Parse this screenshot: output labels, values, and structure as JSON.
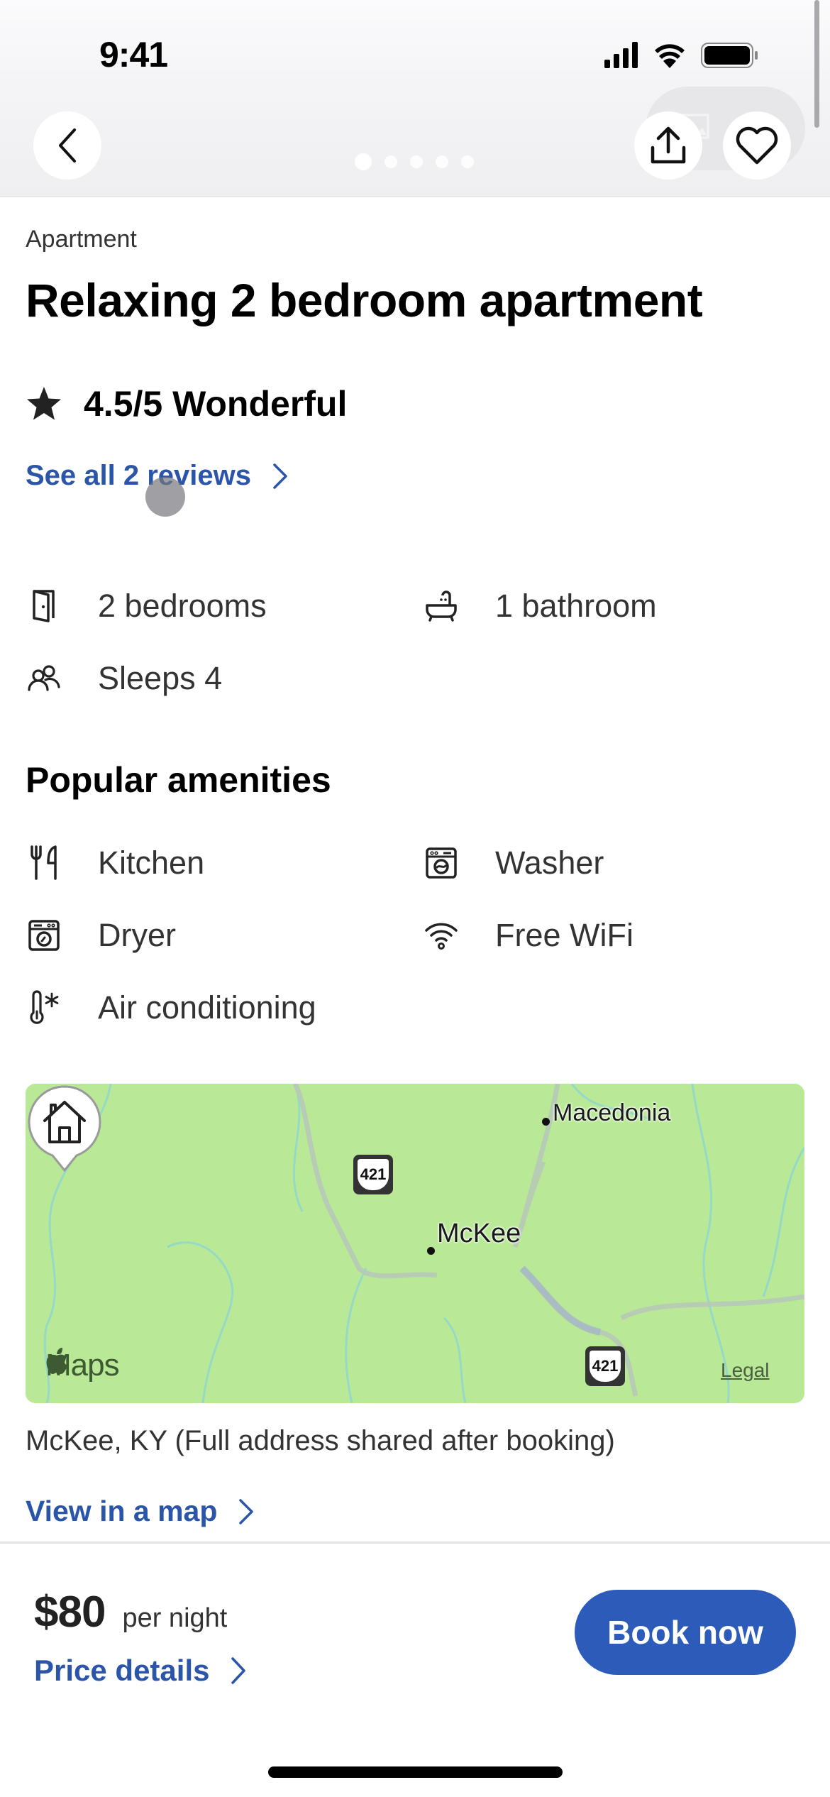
{
  "status_bar": {
    "time": "9:41",
    "icons": [
      "signal-icon",
      "wifi-icon",
      "battery-icon"
    ]
  },
  "header": {
    "back_icon": "chevron-left-icon",
    "share_icon": "share-icon",
    "favorite_icon": "heart-outline-icon",
    "gallery_dots": {
      "count": 5,
      "active_index": 0
    }
  },
  "listing": {
    "type": "Apartment",
    "title": "Relaxing 2 bedroom apartment",
    "rating": {
      "icon": "star-icon",
      "text": "4.5/5 Wonderful"
    },
    "reviews_link": "See all 2 reviews"
  },
  "facts": [
    {
      "icon": "door-icon",
      "label": "2 bedrooms"
    },
    {
      "icon": "bathtub-icon",
      "label": "1 bathroom"
    },
    {
      "icon": "people-icon",
      "label": "Sleeps 4"
    }
  ],
  "amenities": {
    "title": "Popular amenities",
    "items": [
      {
        "icon": "utensils-icon",
        "label": "Kitchen"
      },
      {
        "icon": "washer-icon",
        "label": "Washer"
      },
      {
        "icon": "dryer-icon",
        "label": "Dryer"
      },
      {
        "icon": "wifi-icon",
        "label": "Free WiFi"
      },
      {
        "icon": "thermometer-snowflake-icon",
        "label": "Air conditioning"
      }
    ]
  },
  "map": {
    "labels": {
      "town_1": "Macedonia",
      "town_2": "McKee"
    },
    "route_shield": "421",
    "brand": "Maps",
    "legal": "Legal",
    "pin_icon": "house-icon"
  },
  "location": {
    "address": "McKee, KY (Full address shared after booking)",
    "map_link": "View in a map"
  },
  "booking": {
    "price": "$80",
    "unit": "per night",
    "details_link": "Price details",
    "cta": "Book now"
  },
  "colors": {
    "link": "#2b55a8",
    "primary_button": "#2c5bb9",
    "map_land": "#b9ec96"
  }
}
